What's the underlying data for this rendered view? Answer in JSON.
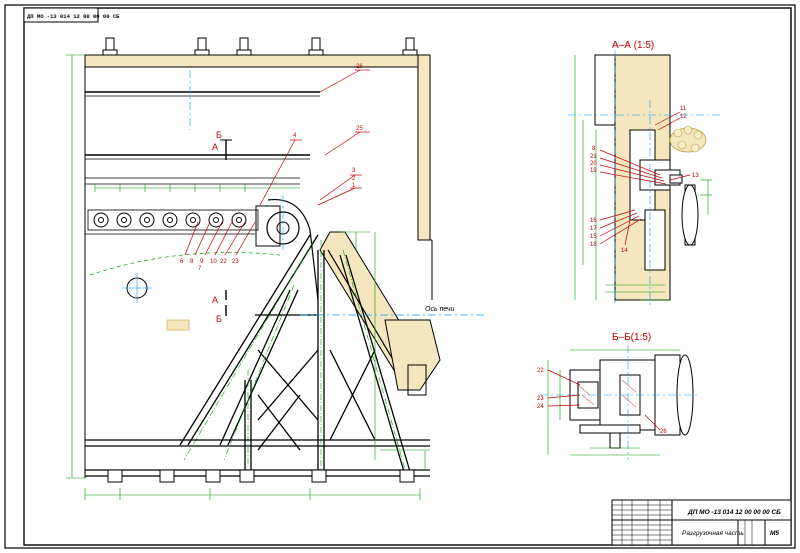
{
  "stamp": {
    "code": "ДП МО -13 014 12 00 00 00 СБ"
  },
  "top_code": "ДП МО -13 014 12 00 00 00 СБ",
  "views": {
    "section_a": "А–А (1:5)",
    "section_b": "Б–Б(1:5)"
  },
  "section_marks": {
    "a": "А",
    "b": "Б"
  },
  "axis_label": "Ось печи",
  "title_block": {
    "code": "ДП МО -13 014 12 00 00 00 СБ",
    "name": "Разгрузочная часть",
    "sheet_mark": "М5"
  },
  "callouts_main": [
    "4",
    "3",
    "2",
    "1",
    "6",
    "8",
    "9",
    "7",
    "10",
    "22",
    "23",
    "25",
    "26"
  ],
  "callouts_a": [
    "11",
    "12",
    "8",
    "21",
    "20",
    "19",
    "13",
    "16",
    "17",
    "15",
    "18",
    "14"
  ],
  "callouts_b": [
    "22",
    "23",
    "24",
    "26"
  ],
  "colors": {
    "frame": "#000000",
    "geometry": "#000000",
    "dimension": "#00a000",
    "centerline": "#00a0ff",
    "callout": "#c00000",
    "refractory": "#f4e6bf"
  }
}
